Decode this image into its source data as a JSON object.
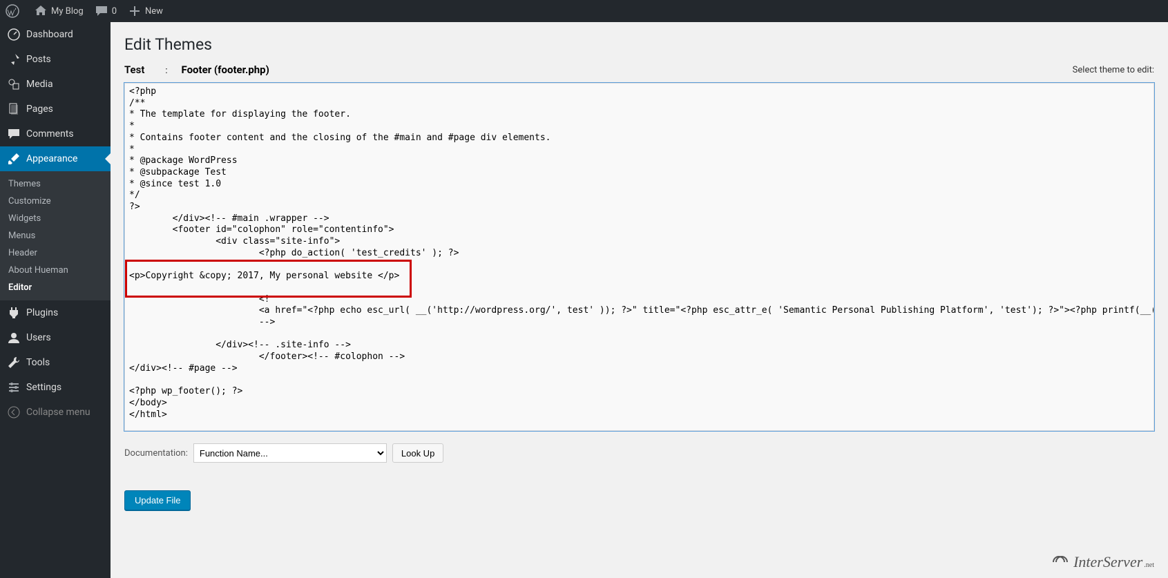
{
  "adminbar": {
    "site_name": "My Blog",
    "comments_count": "0",
    "new_label": "New"
  },
  "sidebar": {
    "dashboard": "Dashboard",
    "posts": "Posts",
    "media": "Media",
    "pages": "Pages",
    "comments": "Comments",
    "appearance": "Appearance",
    "submenu": {
      "themes": "Themes",
      "customize": "Customize",
      "widgets": "Widgets",
      "menus": "Menus",
      "header": "Header",
      "about_hueman": "About Hueman",
      "editor": "Editor"
    },
    "plugins": "Plugins",
    "users": "Users",
    "tools": "Tools",
    "settings": "Settings",
    "collapse": "Collapse menu"
  },
  "page": {
    "heading": "Edit Themes",
    "theme_name": "Test",
    "colon": ":",
    "file_label": "Footer (footer.php)",
    "select_theme_label": "Select theme to edit:",
    "code": "<?php\n/**\n* The template for displaying the footer.\n*\n* Contains footer content and the closing of the #main and #page div elements.\n*\n* @package WordPress\n* @subpackage Test\n* @since test 1.0\n*/\n?>\n        </div><!-- #main .wrapper -->\n        <footer id=\"colophon\" role=\"contentinfo\">\n                <div class=\"site-info\">\n                        <?php do_action( 'test_credits' ); ?>\n\n<p>Copyright &copy; 2017, My personal website </p>\n\n                        <!\n                        <a href=\"<?php echo esc_url( __('http://wordpress.org/', test' )); ?>\" title=\"<?php esc_attr_e( 'Semantic Personal Publishing Platform', 'test'); ?>\"><?php printf(__( 'Proudly powered by %s' ,'test' ), 'WordPress' ); ?></a> - <a href=\"http://www.example.com\">Example </a&gt\n                        -->\n\n                </div><!-- .site-info -->\n                        </footer><!-- #colophon -->\n</div><!-- #page -->\n\n<?php wp_footer(); ?>\n</body>\n</html>",
    "documentation_label": "Documentation:",
    "function_name_placeholder": "Function Name...",
    "lookup_button": "Look Up",
    "update_button": "Update File"
  },
  "watermark": {
    "brand": "InterServer",
    "suffix": ".net"
  }
}
